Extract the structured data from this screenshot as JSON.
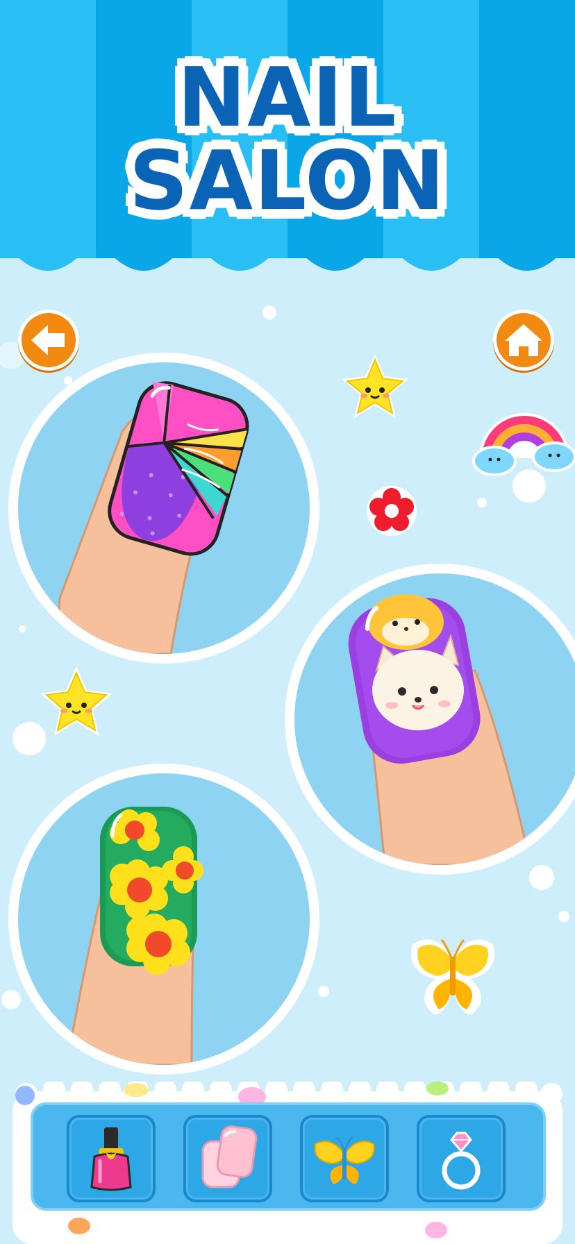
{
  "title": {
    "line1": "NAIL",
    "line2": "SALON"
  },
  "colors": {
    "sky": "#cfeefc",
    "awning_dark": "#0aa7e8",
    "awning_light": "#29bff5",
    "title_blue": "#0a63b5",
    "button_orange": "#f28a12",
    "tray_blue": "#4bb7ef"
  },
  "nav": {
    "back_icon": "back-arrow-icon",
    "home_icon": "home-icon"
  },
  "designs": [
    {
      "name": "rainbow-glitter-design"
    },
    {
      "name": "kitten-design"
    },
    {
      "name": "sunflower-design"
    }
  ],
  "stickers": [
    "smiling-star",
    "rainbow-with-clouds",
    "red-flower",
    "smiling-star",
    "yellow-butterfly"
  ],
  "toolbar": [
    {
      "name": "nail-polish-tool",
      "icon": "nail-polish-icon"
    },
    {
      "name": "nail-tip-tool",
      "icon": "false-nail-icon"
    },
    {
      "name": "butterfly-sticker-tool",
      "icon": "butterfly-icon"
    },
    {
      "name": "ring-tool",
      "icon": "diamond-ring-icon"
    }
  ]
}
